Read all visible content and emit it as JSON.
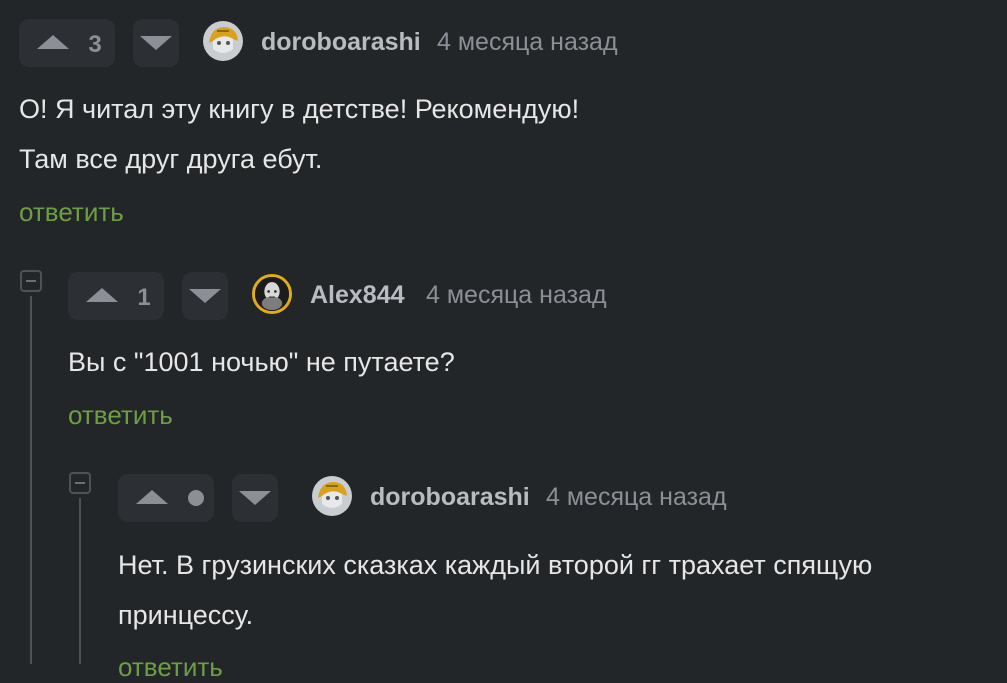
{
  "comments": [
    {
      "rating": "3",
      "username": "doroboarashi",
      "time": "4 месяца назад",
      "lines": [
        "О! Я читал эту книгу в детстве! Рекомендую!",
        "Там все друг друга ебут."
      ],
      "reply_label": "ответить",
      "avatar_icon": "gold-helmet-avatar"
    },
    {
      "rating": "1",
      "username": "Alex844",
      "time": "4 месяца назад",
      "lines": [
        "Вы с \"1001 ночью\" не путаете?"
      ],
      "reply_label": "ответить",
      "avatar_icon": "bald-man-avatar"
    },
    {
      "rating": "",
      "username": "doroboarashi",
      "time": "4 месяца назад",
      "lines": [
        "Нет. В грузинских сказках каждый второй гг трахает спящую",
        "принцессу."
      ],
      "reply_label": "ответить",
      "avatar_icon": "gold-helmet-avatar"
    }
  ],
  "colors": {
    "background": "#232629",
    "reply": "#6e9e43",
    "avatar_ring": "#e0ac17"
  }
}
